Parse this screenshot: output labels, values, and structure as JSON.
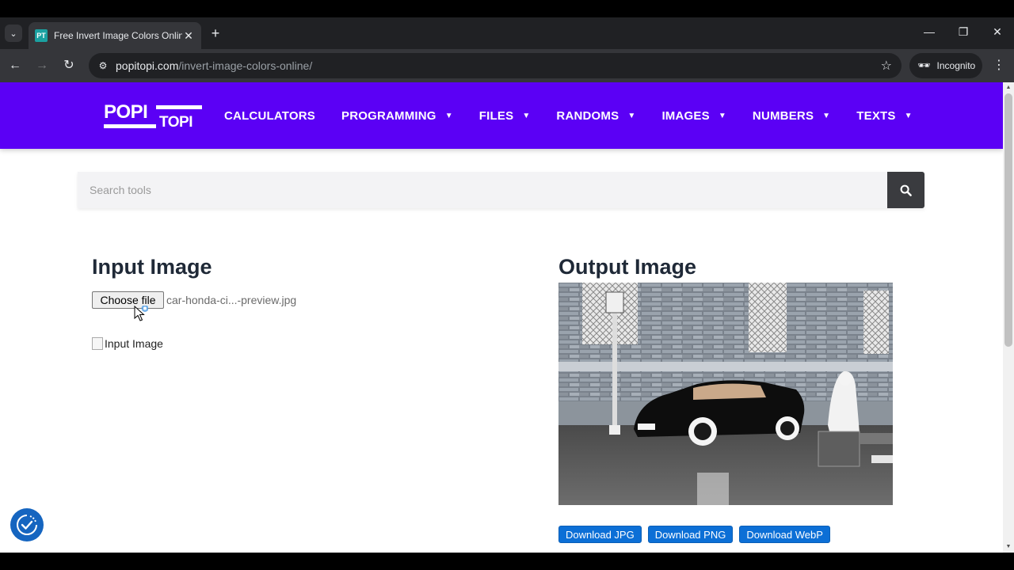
{
  "browser": {
    "tab_title": "Free Invert Image Colors Online",
    "favicon_text": "PT",
    "url_host": "popitopi.com",
    "url_path": "/invert-image-colors-online/",
    "incognito_label": "Incognito"
  },
  "site": {
    "logo_line1": "POPI",
    "logo_line2": "TOPI",
    "nav": [
      {
        "label": "CALCULATORS",
        "has_dropdown": false
      },
      {
        "label": "PROGRAMMING",
        "has_dropdown": true
      },
      {
        "label": "FILES",
        "has_dropdown": true
      },
      {
        "label": "RANDOMS",
        "has_dropdown": true
      },
      {
        "label": "IMAGES",
        "has_dropdown": true
      },
      {
        "label": "NUMBERS",
        "has_dropdown": true
      },
      {
        "label": "TEXTS",
        "has_dropdown": true
      }
    ],
    "brand_color": "#5b00f5"
  },
  "search": {
    "placeholder": "Search tools"
  },
  "input_section": {
    "heading": "Input Image",
    "file_button_label": "Choose file",
    "file_name": "car-honda-ci...-preview.jpg",
    "image_alt": "Input Image"
  },
  "output_section": {
    "heading": "Output Image",
    "download_buttons": [
      "Download JPG",
      "Download PNG",
      "Download WebP"
    ]
  },
  "colors": {
    "download_button": "#0c6fd6",
    "search_button": "#3a3b3f"
  }
}
